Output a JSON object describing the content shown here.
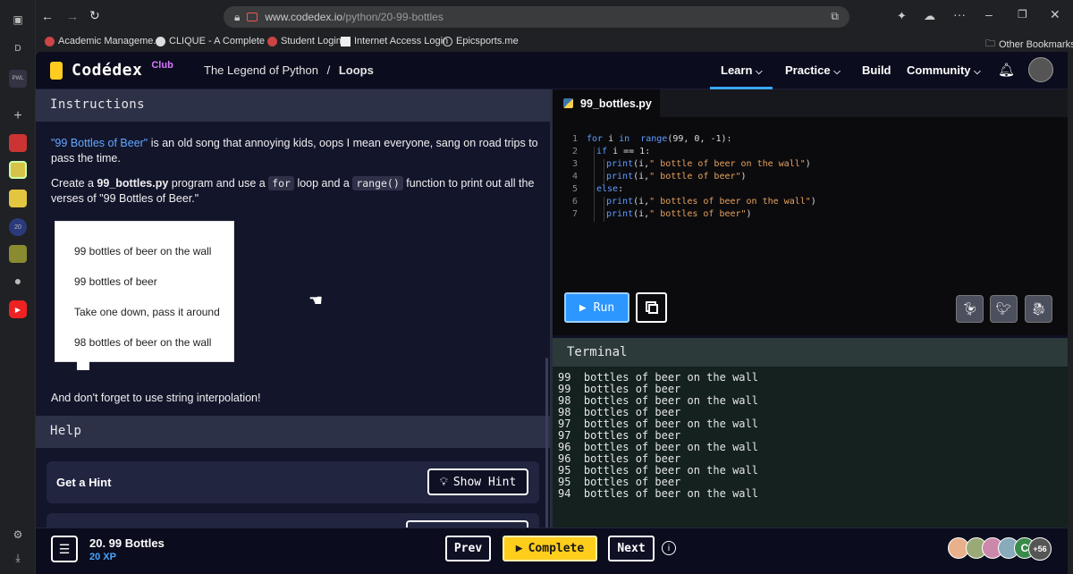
{
  "browser": {
    "url_domain": "www.codedex.io",
    "url_path": "/python/20-99-bottles",
    "sidebar_letter": "D",
    "bookmarks": [
      "Academic Manageme...",
      "CLIQUE - A Complete ...",
      "Student Login",
      "Internet Access Login",
      "Epicsports.me"
    ],
    "other_bookmarks": "Other Bookmarks"
  },
  "nav": {
    "logo": "Codédex",
    "club": "Club",
    "course": "The Legend of Python",
    "separator": "/",
    "chapter": "Loops",
    "links": [
      "Learn",
      "Practice",
      "Build",
      "Community"
    ]
  },
  "instructions": {
    "header": "Instructions",
    "p1_link": "\"99 Bottles of Beer\"",
    "p1_rest": " is an old song that annoying kids, oops I mean everyone, sang on road trips to pass the time.",
    "p2_a": "Create a ",
    "p2_file": "99_bottles.py",
    "p2_b": " program and use a ",
    "p2_code1": "for",
    "p2_c": " loop and a ",
    "p2_code2": "range()",
    "p2_d": " function to print out all the verses of \"99 Bottles of Beer.\"",
    "lyrics": [
      "99 bottles of beer on the wall",
      "99 bottles of beer",
      "Take one down, pass it around",
      "98 bottles of beer on the wall"
    ],
    "p3": "And don't forget to use string interpolation!"
  },
  "help": {
    "header": "Help",
    "hint_label": "Get a Hint",
    "hint_button": "Show Hint"
  },
  "editor": {
    "filename": "99_bottles.py",
    "lines": [
      {
        "n": "1",
        "indent": 0,
        "parts": [
          [
            "kw",
            "for"
          ],
          [
            "",
            "i "
          ],
          [
            "kw",
            "in"
          ],
          [
            "",
            ""
          ],
          [
            "fn",
            " range"
          ],
          [
            "",
            "(99, 0, -1):"
          ]
        ]
      },
      {
        "n": "2",
        "indent": 1,
        "parts": [
          [
            "kw",
            "if"
          ],
          [
            "",
            " i == 1:"
          ]
        ]
      },
      {
        "n": "3",
        "indent": 2,
        "parts": [
          [
            "fn",
            "print"
          ],
          [
            "",
            "(i,"
          ],
          [
            "str",
            "\" bottle of beer on the wall\""
          ],
          [
            "",
            ")"
          ]
        ]
      },
      {
        "n": "4",
        "indent": 2,
        "parts": [
          [
            "fn",
            "print"
          ],
          [
            "",
            "(i,"
          ],
          [
            "str",
            "\" bottle of beer\""
          ],
          [
            "",
            ")"
          ]
        ]
      },
      {
        "n": "5",
        "indent": 1,
        "parts": [
          [
            "kw",
            "else"
          ],
          [
            "",
            ":"
          ]
        ]
      },
      {
        "n": "6",
        "indent": 2,
        "parts": [
          [
            "fn",
            "print"
          ],
          [
            "",
            "(i,"
          ],
          [
            "str",
            "\" bottles of beer on the wall\""
          ],
          [
            "",
            ")"
          ]
        ]
      },
      {
        "n": "7",
        "indent": 2,
        "parts": [
          [
            "fn",
            "print"
          ],
          [
            "",
            "(i,"
          ],
          [
            "str",
            "\" bottles of beer\""
          ],
          [
            "",
            ")"
          ]
        ]
      }
    ],
    "run_label": "Run"
  },
  "terminal": {
    "header": "Terminal",
    "output": [
      "99  bottles of beer on the wall",
      "99  bottles of beer",
      "98  bottles of beer on the wall",
      "98  bottles of beer",
      "97  bottles of beer on the wall",
      "97  bottles of beer",
      "96  bottles of beer on the wall",
      "96  bottles of beer",
      "95  bottles of beer on the wall",
      "95  bottles of beer",
      "94  bottles of beer on the wall"
    ]
  },
  "bottom": {
    "exercise": "20. 99 Bottles",
    "xp": "20 XP",
    "prev": "Prev",
    "complete": "Complete",
    "next": "Next",
    "avatar_extra": "+56",
    "avatar_letter": "C"
  },
  "colors": {
    "accent": "#2c97ff",
    "complete": "#ffcd1c",
    "keyword": "#5f9cff",
    "string": "#e7a15c"
  }
}
